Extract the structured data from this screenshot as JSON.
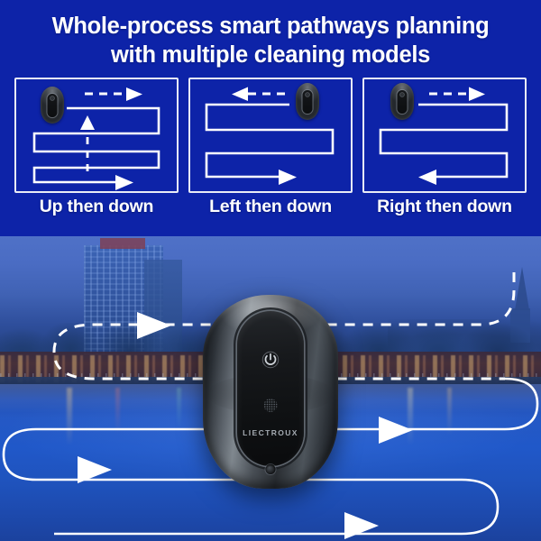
{
  "headline": {
    "line1": "Whole-process smart pathways planning",
    "line2": "with multiple cleaning models"
  },
  "panels": [
    {
      "id": "up-then-down",
      "label": "Up then down",
      "robot_icon": "window-cleaning-robot-icon",
      "robot_position": "top-left",
      "arrow_direction": "up",
      "dashed_arrow": "up-arrow-dashed",
      "solid_arrow": "right-arrow-solid"
    },
    {
      "id": "left-then-down",
      "label": "Left then down",
      "robot_icon": "window-cleaning-robot-icon",
      "robot_position": "top-right",
      "arrow_direction": "left",
      "dashed_arrow": "left-arrow-dashed",
      "solid_arrow": "right-arrow-solid"
    },
    {
      "id": "right-then-down",
      "label": "Right then down",
      "robot_icon": "window-cleaning-robot-icon",
      "robot_position": "top-left",
      "arrow_direction": "right",
      "dashed_arrow": "right-arrow-dashed",
      "solid_arrow": "left-arrow-solid"
    }
  ],
  "product": {
    "brand": "LIECTROUX",
    "power_icon": "power-button-icon",
    "speaker_icon": "speaker-grille-icon",
    "sensor_icon": "sensor-icon"
  },
  "scene": {
    "description": "night city riverside skyline",
    "path_arrows": [
      "dashed-arrow-right-upper",
      "solid-arrow-right-middle",
      "solid-arrow-right-lower"
    ]
  },
  "colors": {
    "brand_blue": "#0d23a8",
    "panel_stroke": "#e9ecf6",
    "path_white": "#ffffff",
    "water_blue": "#2156c4",
    "sky_blue": "#4a6cc3"
  }
}
